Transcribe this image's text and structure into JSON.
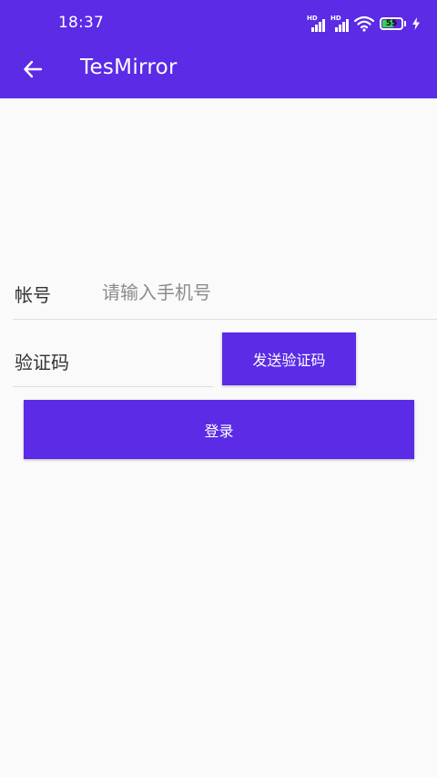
{
  "status_bar": {
    "time": "18:37",
    "signal_tag_1": "HD",
    "signal_tag_2": "HD",
    "battery_percent": "55",
    "icons": [
      "signal-icon",
      "signal-icon",
      "wifi-icon",
      "battery-icon",
      "charging-icon"
    ],
    "battery_fill_color": "#39d353"
  },
  "toolbar": {
    "title": "TesMirror",
    "back_icon": "arrow-left-icon"
  },
  "form": {
    "account_label": "帐号",
    "account_placeholder": "请输入手机号",
    "account_value": "",
    "code_label": "验证码",
    "code_placeholder": "",
    "code_value": "",
    "send_code_button": "发送验证码",
    "login_button": "登录"
  },
  "colors": {
    "primary": "#5b2be6",
    "background": "#fafafa",
    "label_text": "#333333",
    "placeholder_text": "#8c8c8c"
  }
}
